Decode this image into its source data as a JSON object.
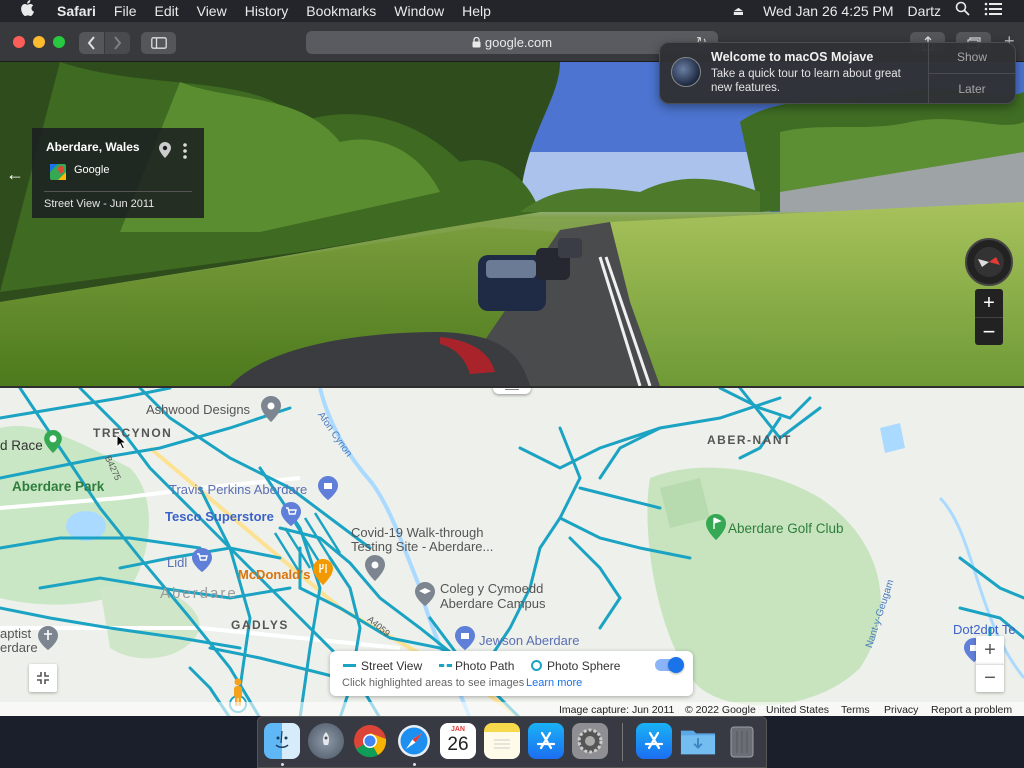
{
  "menubar": {
    "apple": "",
    "app": "Safari",
    "menus": [
      "File",
      "Edit",
      "View",
      "History",
      "Bookmarks",
      "Window",
      "Help"
    ],
    "datetime": "Wed Jan 26  4:25 PM",
    "user": "Dartz"
  },
  "toolbar": {
    "url": "google.com"
  },
  "notification": {
    "title": "Welcome to macOS Mojave",
    "body_line1": "Take a quick tour to learn about great",
    "body_line2": "new features.",
    "show_label": "Show",
    "later_label": "Later"
  },
  "streetview": {
    "place": "Aberdare, Wales",
    "brand": "Google",
    "date": "Street View - Jun 2011"
  },
  "map": {
    "labels": {
      "ashwood": "Ashwood Designs",
      "trecynon": "TRECYNON",
      "race": "d Race",
      "aberdare_park": "Aberdare Park",
      "travis": "Travis Perkins Aberdare",
      "tesco": "Tesco Superstore",
      "lidl": "Lidl",
      "mcdonalds": "McDonald's",
      "aberdare": "Aberdare",
      "gadlys": "GADLYS",
      "aptist_line1": "aptist",
      "aptist_line2": "erdare",
      "covid_line1": "Covid-19 Walk-through",
      "covid_line2": "Testing Site - Aberdare...",
      "coleg_line1": "Coleg y Cymoedd",
      "coleg_line2": "Aberdare Campus",
      "jewson": "Jewson Aberdare",
      "abernant": "ABER-NANT",
      "golf": "Aberdare Golf Club",
      "dot2dot": "Dot2dot Te",
      "afon_cynon": "Afon Cynon",
      "nant_y_geugam": "Nant-y-Geugam",
      "a4059": "A4059",
      "b4275": "B4275"
    },
    "legend": {
      "street_view": "Street View",
      "photo_path": "Photo Path",
      "photo_sphere": "Photo Sphere",
      "hint": "Click highlighted areas to see images",
      "learn_more": "Learn more",
      "toggle_on": true
    },
    "footer": {
      "capture": "Image capture: Jun 2011",
      "copyright": "© 2022 Google",
      "region": "United States",
      "terms": "Terms",
      "privacy": "Privacy",
      "report": "Report a problem"
    }
  },
  "dock": {
    "apps": [
      "finder-icon",
      "launchpad-icon",
      "chrome-icon",
      "safari-icon",
      "calendar-icon",
      "notes-icon",
      "app-store-icon",
      "system-preferences-icon",
      "app-store-icon-2",
      "downloads-folder-icon",
      "trash-icon"
    ],
    "calendar_month": "JAN",
    "calendar_day": "26"
  },
  "colors": {
    "road_highlight": "#1ba3c3",
    "accent_blue": "#1a73e8"
  }
}
